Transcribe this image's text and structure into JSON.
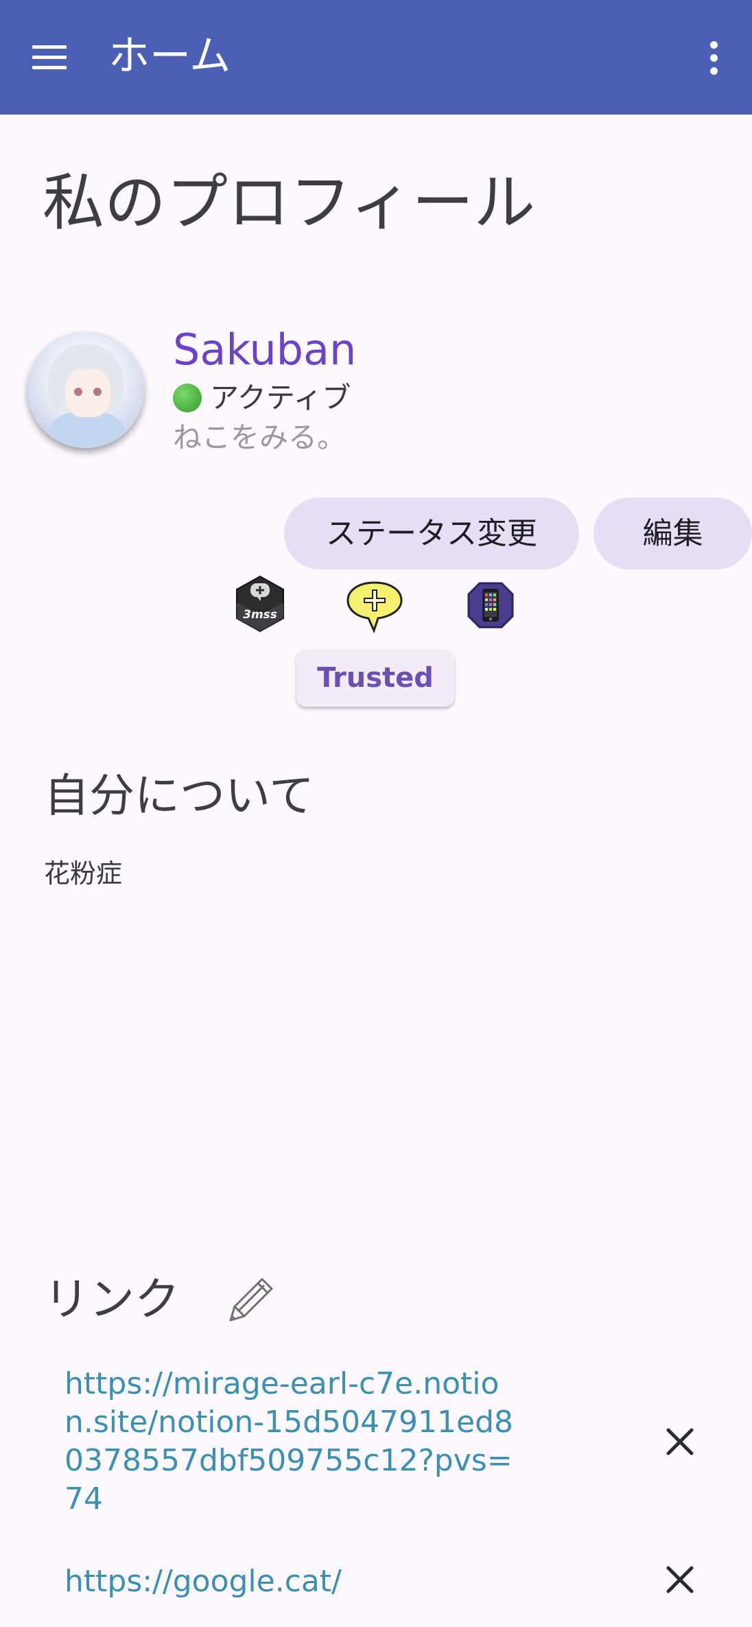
{
  "appbar": {
    "title": "ホーム",
    "color": "#4b5fb4",
    "menu_icon": "hamburger-menu-icon",
    "overflow_icon": "more-vert-icon"
  },
  "page": {
    "title": "私のプロフィール"
  },
  "profile": {
    "username": "Sakuban",
    "status": "アクティブ",
    "status_color": "#2f9a2a",
    "status_description": "ねこをみる。",
    "buttons": {
      "change_status": "ステータス変更",
      "edit": "編集"
    },
    "badges": [
      "speech-hex-badge-icon",
      "plus-speech-badge-icon",
      "phone-badge-icon"
    ],
    "badge_hex_text": "3mss",
    "trust_tag": "Trusted"
  },
  "about": {
    "heading": "自分について",
    "text": "花粉症"
  },
  "links": {
    "heading": "リンク",
    "edit_icon": "pencil-icon",
    "items": [
      {
        "url": "https://mirage-earl-c7e.notion.site/notion-15d5047911ed80378557dbf509755c12?pvs=74"
      },
      {
        "url": "https://google.cat/"
      }
    ]
  }
}
